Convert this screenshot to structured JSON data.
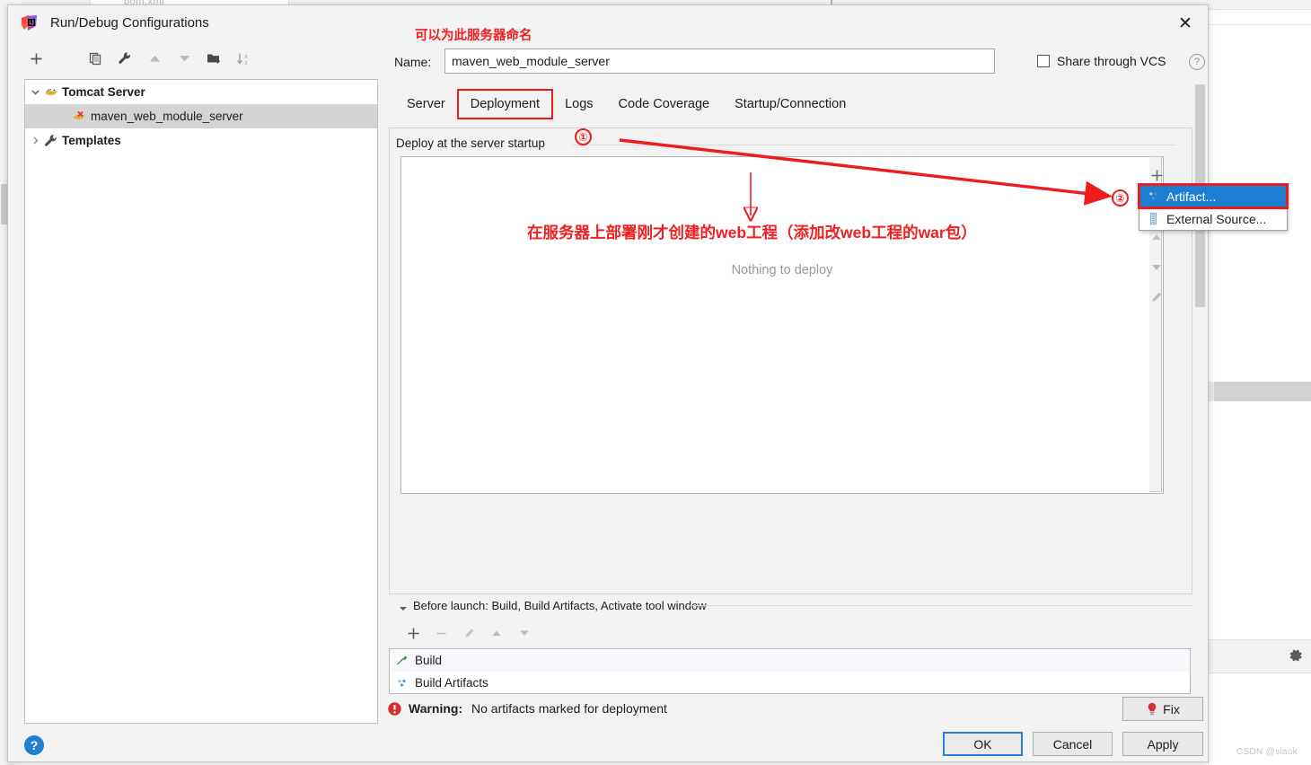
{
  "background": {
    "tab_label": "pom.xml",
    "watermark": "CSDN @siaok",
    "gear_icon": "gear-icon"
  },
  "dialog": {
    "title": "Run/Debug Configurations",
    "title_icon": "intellij-idea-icon",
    "close_label": "✕",
    "help_label": "?"
  },
  "tree_toolbar": [
    {
      "icon": "add-icon",
      "glyph": "+"
    },
    {
      "icon": "remove-icon",
      "glyph": "−"
    },
    {
      "icon": "copy-icon",
      "glyph": ""
    },
    {
      "icon": "wrench-icon",
      "glyph": ""
    },
    {
      "icon": "move-up-icon",
      "glyph": "▲"
    },
    {
      "icon": "move-down-icon",
      "glyph": "▼"
    },
    {
      "icon": "new-folder-icon",
      "glyph": ""
    },
    {
      "icon": "sort-alphabetically-icon",
      "glyph": ""
    }
  ],
  "tree": [
    {
      "label": "Tomcat Server",
      "level": 0,
      "expanded": true,
      "selected": false,
      "icon": "tomcat-icon",
      "chevron": "chevron-down-icon"
    },
    {
      "label": "maven_web_module_server",
      "level": 1,
      "expanded": false,
      "selected": true,
      "icon": "tomcat-error-icon",
      "chevron": ""
    },
    {
      "label": "Templates",
      "level": 0,
      "expanded": false,
      "selected": false,
      "icon": "wrench-icon",
      "chevron": "chevron-right-icon"
    }
  ],
  "form": {
    "name_label": "Name:",
    "name_value": "maven_web_module_server",
    "name_placeholder": "Name",
    "share_label": "Share through VCS",
    "share_checked": false
  },
  "tabs": [
    {
      "label": "Server",
      "active": false,
      "highlighted": false
    },
    {
      "label": "Deployment",
      "active": true,
      "highlighted": true
    },
    {
      "label": "Logs",
      "active": false,
      "highlighted": false
    },
    {
      "label": "Code Coverage",
      "active": false,
      "highlighted": false
    },
    {
      "label": "Startup/Connection",
      "active": false,
      "highlighted": false
    }
  ],
  "deployment": {
    "legend": "Deploy at the server startup",
    "empty_text": "Nothing to deploy",
    "side_tools": [
      {
        "icon": "add-icon",
        "glyph": "+"
      },
      {
        "icon": "remove-icon",
        "glyph": "−"
      },
      {
        "icon": "move-up-icon",
        "glyph": "▲"
      },
      {
        "icon": "move-down-icon",
        "glyph": "▼"
      },
      {
        "icon": "edit-pencil-icon",
        "glyph": ""
      }
    ]
  },
  "menu": {
    "items": [
      {
        "label": "Artifact...",
        "icon": "artifact-icon",
        "selected": true
      },
      {
        "label": "External Source...",
        "icon": "external-source-icon",
        "selected": false
      }
    ]
  },
  "before_launch": {
    "title": "Before launch: Build, Build Artifacts, Activate tool window",
    "toolbar": [
      {
        "icon": "add-icon",
        "glyph": "+"
      },
      {
        "icon": "remove-icon",
        "glyph": "−"
      },
      {
        "icon": "edit-pencil-icon",
        "glyph": ""
      },
      {
        "icon": "move-up-icon",
        "glyph": "▲"
      },
      {
        "icon": "move-down-icon",
        "glyph": "▼"
      }
    ],
    "items": [
      {
        "label": "Build",
        "icon": "build-hammer-icon"
      },
      {
        "label": "Build Artifacts",
        "icon": "artifact-icon"
      }
    ]
  },
  "status": {
    "warning_prefix": "Warning:",
    "warning_text": "No artifacts marked for deployment",
    "warning_icon": "error-exclamation-icon"
  },
  "buttons": {
    "fix": "Fix",
    "ok": "OK",
    "cancel": "Cancel",
    "apply": "Apply"
  },
  "annotations": {
    "title_note": "可以为此服务器命名",
    "main_note": "在服务器上部署刚才创建的web工程（添加改web工程的war包）",
    "marker_1": "①",
    "marker_2": "②"
  },
  "colors": {
    "annotation_red": "#f02020",
    "selection_blue": "#1d7fd4",
    "ok_border": "#2a7fd4",
    "warning_red": "#d03030"
  }
}
